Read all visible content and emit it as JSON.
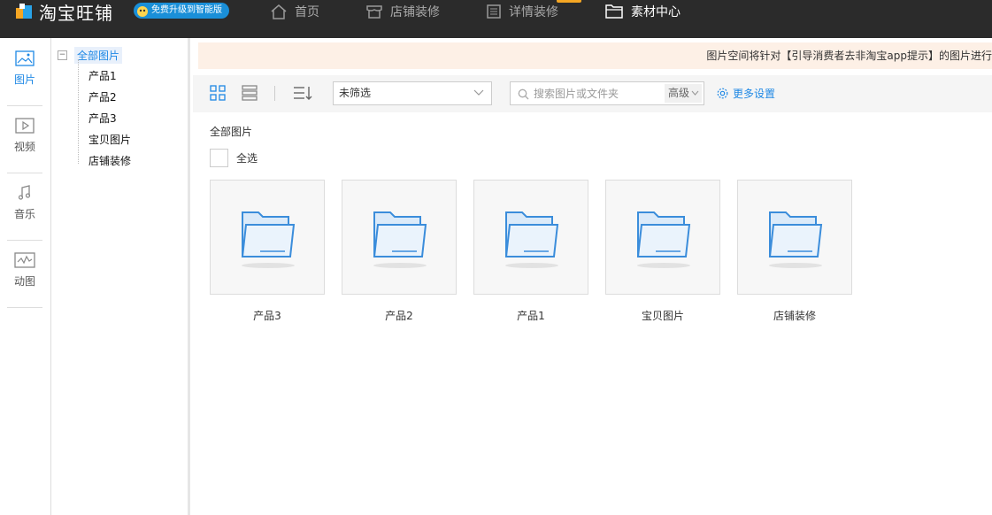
{
  "header": {
    "logo_text": "淘宝旺铺",
    "upgrade_badge": "免费升级到智能版",
    "nav": [
      {
        "label": "首页",
        "icon": "home-icon"
      },
      {
        "label": "店铺装修",
        "icon": "shop-icon"
      },
      {
        "label": "详情装修",
        "icon": "detail-list-icon"
      },
      {
        "label": "素材中心",
        "icon": "folder-icon",
        "active": true
      }
    ]
  },
  "rail": [
    {
      "label": "图片",
      "icon": "image-icon",
      "active": true
    },
    {
      "label": "视频",
      "icon": "video-icon"
    },
    {
      "label": "音乐",
      "icon": "music-icon"
    },
    {
      "label": "动图",
      "icon": "gif-icon"
    }
  ],
  "tree": {
    "root": "全部图片",
    "toggle": "−",
    "children": [
      "产品1",
      "产品2",
      "产品3",
      "宝贝图片",
      "店铺装修"
    ]
  },
  "notice": "图片空间将针对【引导消费者去非淘宝app提示】的图片进行",
  "toolbar": {
    "filter_value": "未筛选",
    "search_placeholder": "搜索图片或文件夹",
    "advanced_label": "高级",
    "more_settings_label": "更多设置"
  },
  "content": {
    "section_title": "全部图片",
    "select_all_label": "全选",
    "folders": [
      "产品3",
      "产品2",
      "产品1",
      "宝贝图片",
      "店铺装修"
    ]
  },
  "colors": {
    "header_bg": "#2b2b2b",
    "accent": "#1e88e5",
    "notice_bg": "#fdf0e6"
  }
}
